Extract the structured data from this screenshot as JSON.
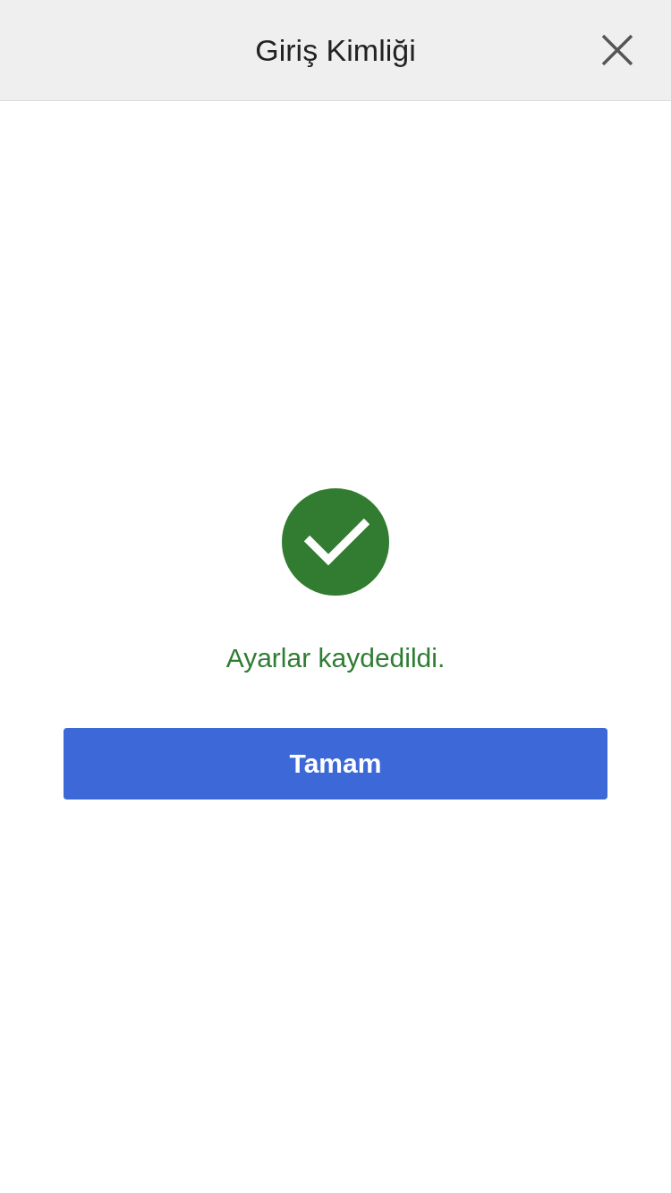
{
  "header": {
    "title": "Giriş Kimliği"
  },
  "result": {
    "kind": "success",
    "message": "Ayarlar kaydedildi."
  },
  "buttons": [
    {
      "label": "Tamam"
    }
  ]
}
